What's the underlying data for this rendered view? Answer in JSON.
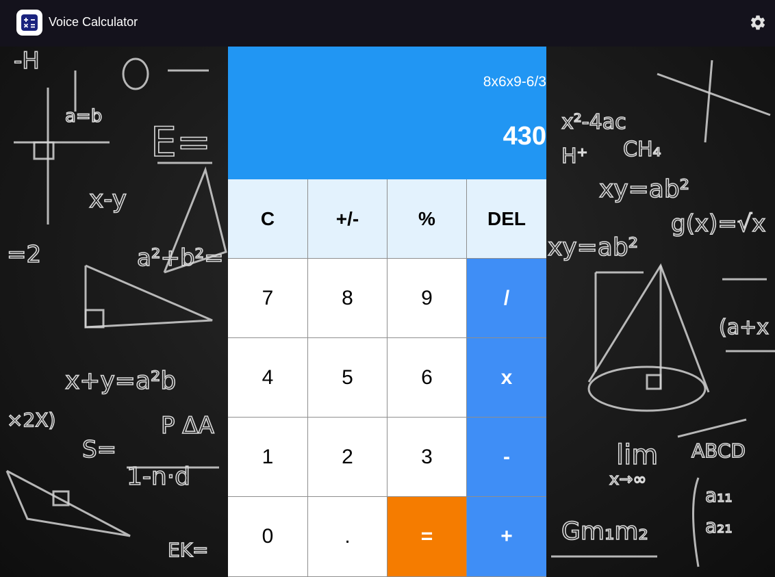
{
  "app": {
    "title": "Voice Calculator",
    "icon": "calculator-icon",
    "settings_icon": "gear-icon"
  },
  "display": {
    "expression": "8x6x9-6/3",
    "result": "430"
  },
  "keys": [
    {
      "label": "C",
      "type": "fn"
    },
    {
      "label": "+/-",
      "type": "fn"
    },
    {
      "label": "%",
      "type": "fn"
    },
    {
      "label": "DEL",
      "type": "fn"
    },
    {
      "label": "7",
      "type": "num"
    },
    {
      "label": "8",
      "type": "num"
    },
    {
      "label": "9",
      "type": "num"
    },
    {
      "label": "/",
      "type": "op"
    },
    {
      "label": "4",
      "type": "num"
    },
    {
      "label": "5",
      "type": "num"
    },
    {
      "label": "6",
      "type": "num"
    },
    {
      "label": "x",
      "type": "op"
    },
    {
      "label": "1",
      "type": "num"
    },
    {
      "label": "2",
      "type": "num"
    },
    {
      "label": "3",
      "type": "num"
    },
    {
      "label": "-",
      "type": "op"
    },
    {
      "label": "0",
      "type": "num"
    },
    {
      "label": ".",
      "type": "num"
    },
    {
      "label": "=",
      "type": "eq"
    },
    {
      "label": "+",
      "type": "op"
    }
  ],
  "colors": {
    "appbar": "#14121c",
    "display": "#2196f3",
    "function_keys": "#e3f2fd",
    "operator_keys": "#3f8ef6",
    "equals_key": "#f57c00"
  }
}
